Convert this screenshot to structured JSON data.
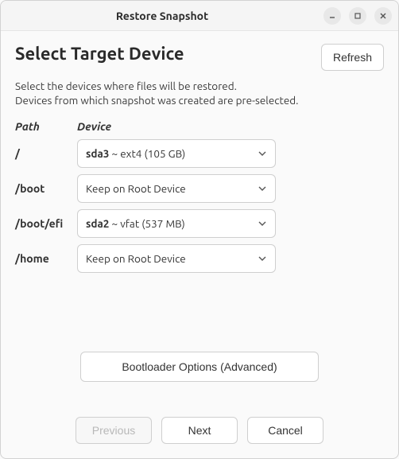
{
  "window": {
    "title": "Restore Snapshot"
  },
  "header": {
    "title": "Select Target Device",
    "refresh": "Refresh"
  },
  "description": {
    "line1": "Select the devices where files will be restored.",
    "line2": "Devices from which snapshot was created are pre-selected."
  },
  "table": {
    "head_path": "Path",
    "head_device": "Device",
    "rows": [
      {
        "path": "/",
        "bold": "sda3",
        "rest": " ~ ext4 (105 GB)"
      },
      {
        "path": "/boot",
        "bold": "",
        "rest": "Keep on Root Device"
      },
      {
        "path": "/boot/efi",
        "bold": "sda2",
        "rest": " ~ vfat (537 MB)"
      },
      {
        "path": "/home",
        "bold": "",
        "rest": "Keep on Root Device"
      }
    ]
  },
  "bootloader_button": "Bootloader Options (Advanced)",
  "footer": {
    "previous": "Previous",
    "next": "Next",
    "cancel": "Cancel"
  }
}
